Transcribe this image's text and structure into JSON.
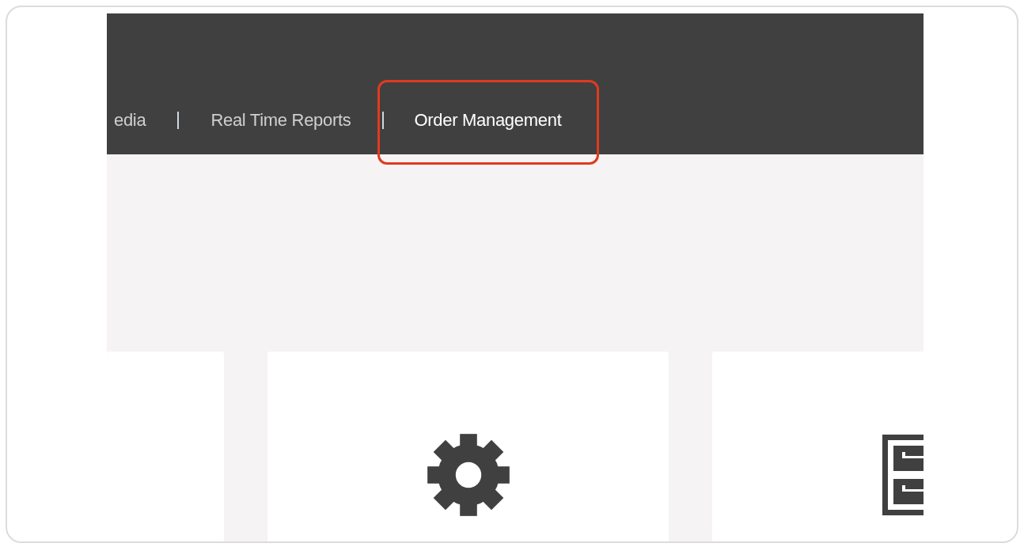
{
  "nav": [
    {
      "label": "edia",
      "selected": false,
      "highlighted": false
    },
    {
      "label": "Real Time Reports",
      "selected": false,
      "highlighted": false
    },
    {
      "label": "Order Management",
      "selected": true,
      "highlighted": true
    }
  ],
  "cards": [
    {
      "kind": "blank"
    },
    {
      "kind": "gear"
    },
    {
      "kind": "cabinet"
    }
  ]
}
